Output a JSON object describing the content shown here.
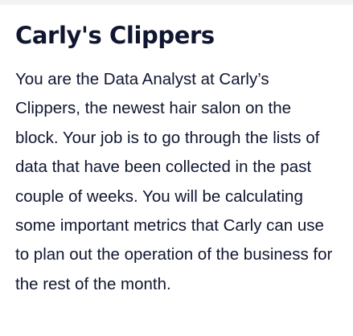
{
  "lesson": {
    "title": "Carly's Clippers",
    "paragraph": "You are the Data Analyst at Carly’s Clippers, the newest hair salon on the block. Your job is to go through the lists of data that have been collected in the past couple of weeks. You will be calculating some important metrics that Carly can use to plan out the operation of the business for the rest of the month."
  },
  "colors": {
    "text": "#10162f",
    "background": "#ffffff",
    "top_strip": "#f3f3f5"
  }
}
